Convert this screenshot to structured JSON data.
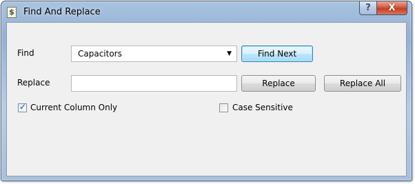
{
  "window": {
    "title": "Find And Replace",
    "app_icon": "dollar-sheet-icon",
    "app_icon_glyph": "$",
    "help_glyph": "?",
    "close_glyph": "X"
  },
  "form": {
    "find_label": "Find",
    "find_value": "Capacitors",
    "replace_label": "Replace",
    "replace_value": ""
  },
  "buttons": {
    "find_next": "Find Next",
    "replace": "Replace",
    "replace_all": "Replace All"
  },
  "options": {
    "current_column_only": {
      "label": "Current Column Only",
      "checked": true
    },
    "case_sensitive": {
      "label": "Case Sensitive",
      "checked": false
    }
  },
  "colors": {
    "frame": "#a9c3e0",
    "client": "#f0f0f0",
    "default_button": "#bee6fd",
    "close_button": "#c94a30"
  }
}
